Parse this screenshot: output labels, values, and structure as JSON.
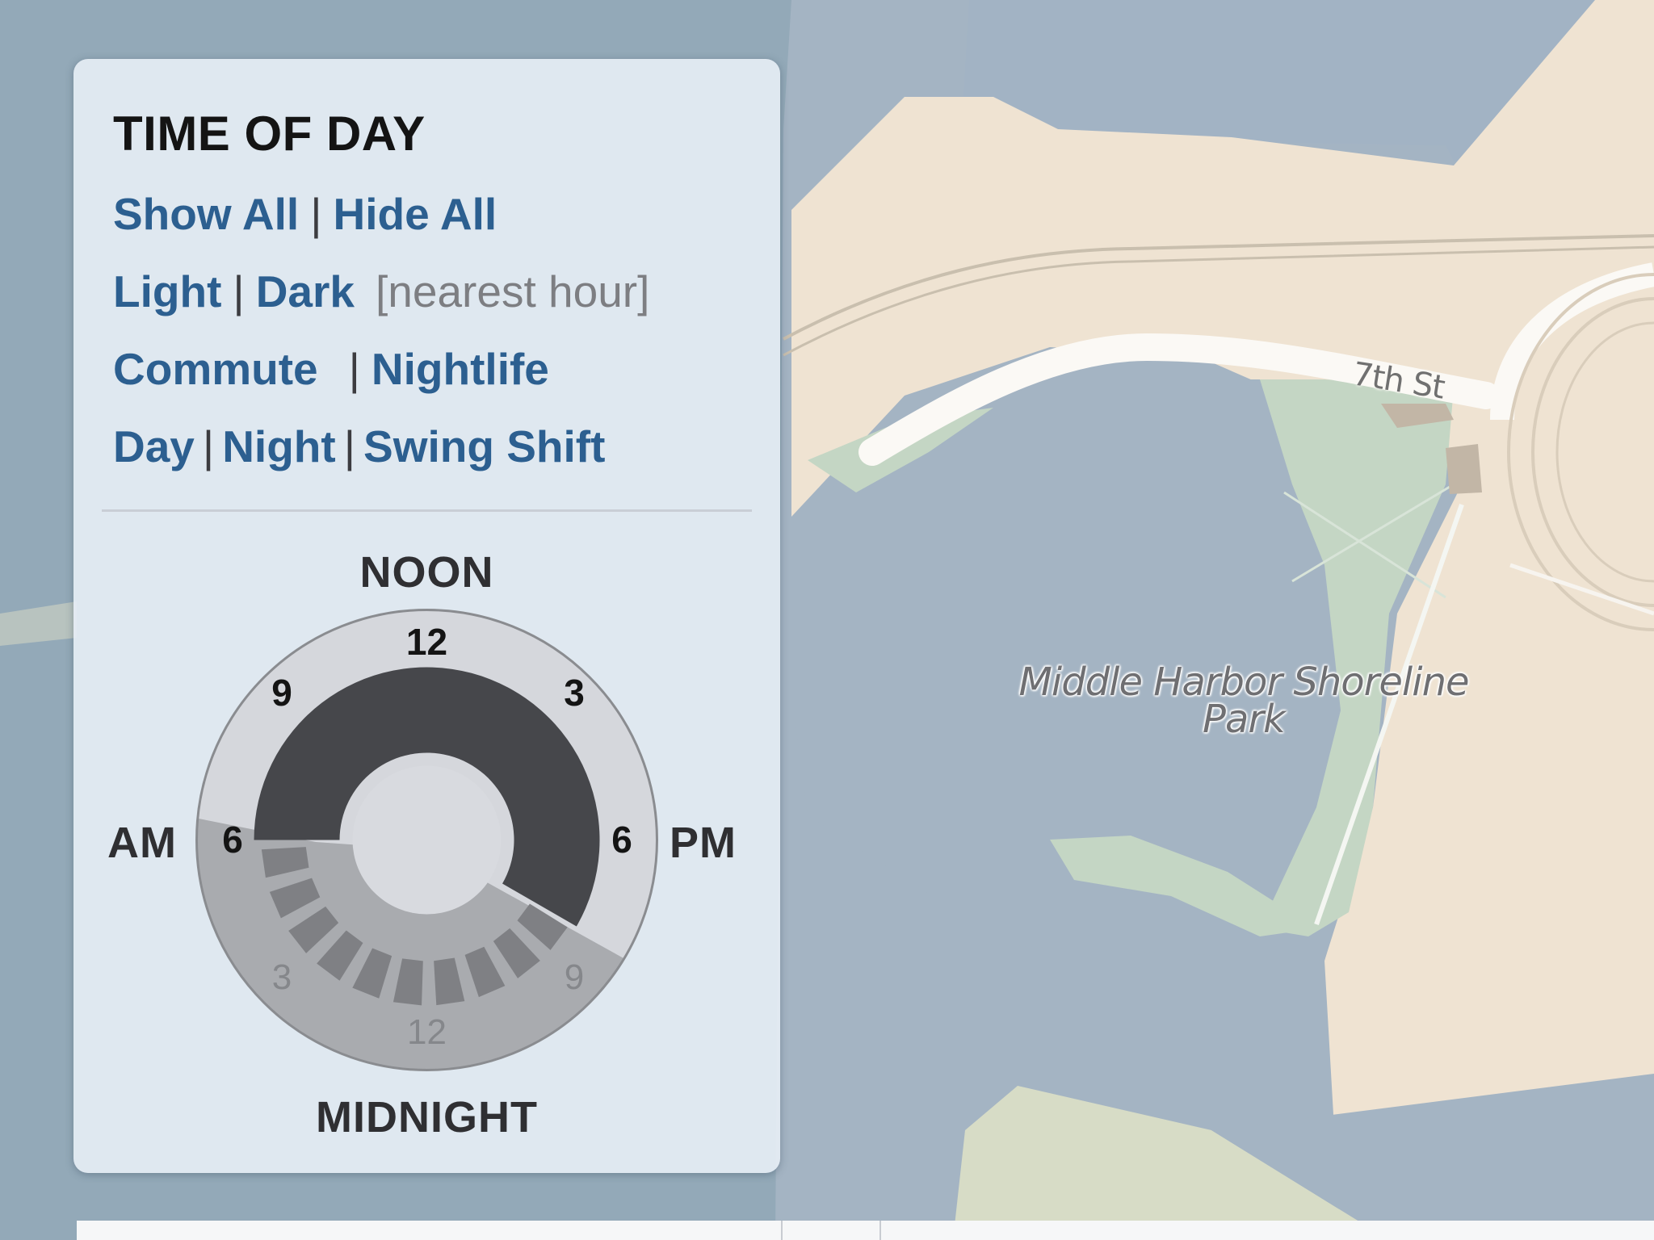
{
  "map": {
    "park_label_line1": "Middle Harbor Shoreline",
    "park_label_line2": "Park",
    "street_label": "7th St"
  },
  "panel": {
    "title": "TIME OF DAY",
    "links": {
      "show_all": "Show All",
      "hide_all": "Hide All",
      "light": "Light",
      "dark": "Dark",
      "nearest_hour_note": "[nearest hour]",
      "commute": "Commute",
      "nightlife": "Nightlife",
      "day": "Day",
      "night": "Night",
      "swing_shift": "Swing Shift"
    },
    "separator": "|",
    "dial": {
      "noon_label": "NOON",
      "midnight_label": "MIDNIGHT",
      "am_label": "AM",
      "pm_label": "PM",
      "hour_labels": {
        "top": "12",
        "upper_left": "9",
        "upper_right": "3",
        "left": "6",
        "right": "6",
        "lower_left": "3",
        "lower_right": "9",
        "bottom": "12"
      },
      "selected_range": {
        "start": "6 AM",
        "end": "8 PM"
      },
      "colors": {
        "selected_arc": "#46474b",
        "day_face": "#d5d7dc",
        "night_face": "#a9abaf",
        "hour_ticks": "#7f8084"
      }
    }
  }
}
